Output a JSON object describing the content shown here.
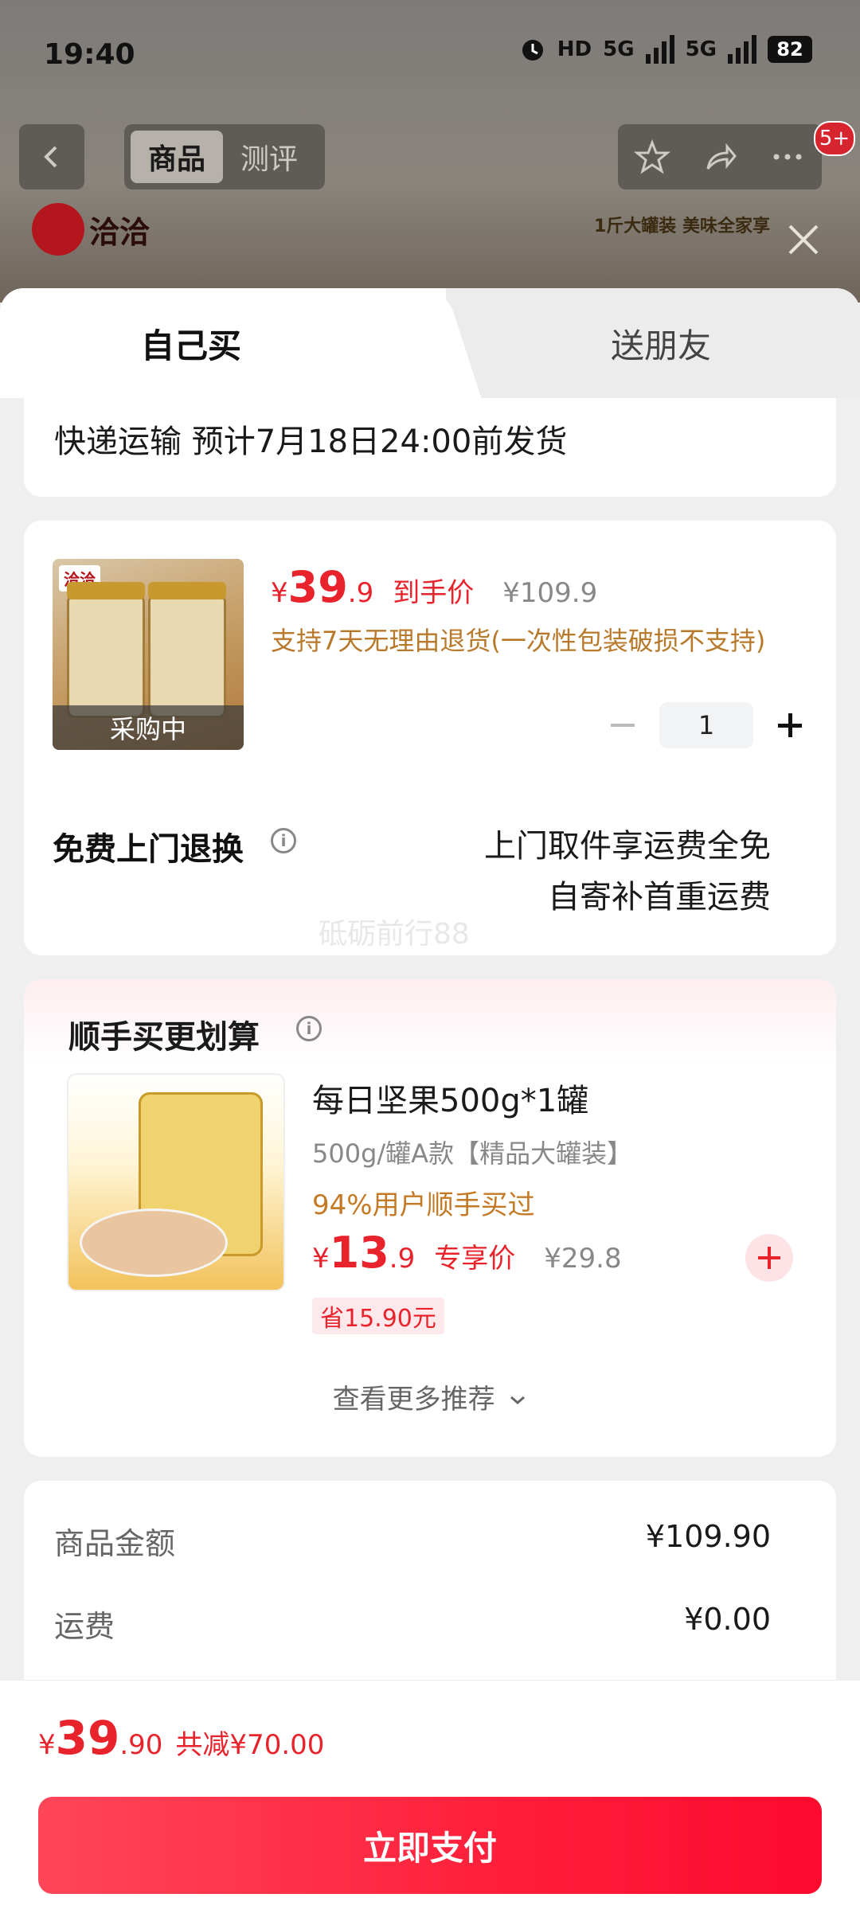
{
  "status_bar": {
    "time": "19:40",
    "hd": "HD",
    "net1": "5G",
    "net2": "5G",
    "battery": "82"
  },
  "top_nav": {
    "tabs": [
      {
        "label": "商品"
      },
      {
        "label": "测评"
      }
    ],
    "badge": "5+",
    "brand": "洽洽",
    "banner_text": "1斤大罐装 美味全家享"
  },
  "sheet": {
    "tabs": {
      "self": "自己买",
      "gift": "送朋友"
    },
    "shipping": "快递运输 预计7月18日24:00前发货",
    "product": {
      "image_status": "采购中",
      "price": {
        "currency": "¥",
        "integer": "39",
        "decimal": ".9",
        "label": "到手价",
        "original": "¥109.9"
      },
      "return_note": "支持7天无理由退货(一次性包装破损不支持)",
      "quantity": "1",
      "free_return_title": "免费上门退换",
      "free_return_line1": "上门取件享运费全免",
      "free_return_line2": "自寄补首重运费",
      "watermark": "砥砺前行88"
    },
    "addon": {
      "title": "顺手买更划算",
      "name": "每日坚果500g*1罐",
      "spec": "500g/罐A款【精品大罐装】",
      "bought": "94%用户顺手买过",
      "price": {
        "currency": "¥",
        "integer": "13",
        "decimal": ".9",
        "label": "专享价",
        "original": "¥29.8"
      },
      "save": "省15.90元",
      "more": "查看更多推荐"
    },
    "summary": [
      {
        "label": "商品金额",
        "value": "¥109.90"
      },
      {
        "label": "运费",
        "value": "¥0.00"
      }
    ]
  },
  "footer": {
    "total": {
      "currency": "¥",
      "integer": "39",
      "decimal": ".90"
    },
    "reduce": "共减¥70.00",
    "pay": "立即支付"
  },
  "colors": {
    "accent": "#e8232c",
    "pay_button": "#ff2a42",
    "orange_note": "#b8792b"
  }
}
